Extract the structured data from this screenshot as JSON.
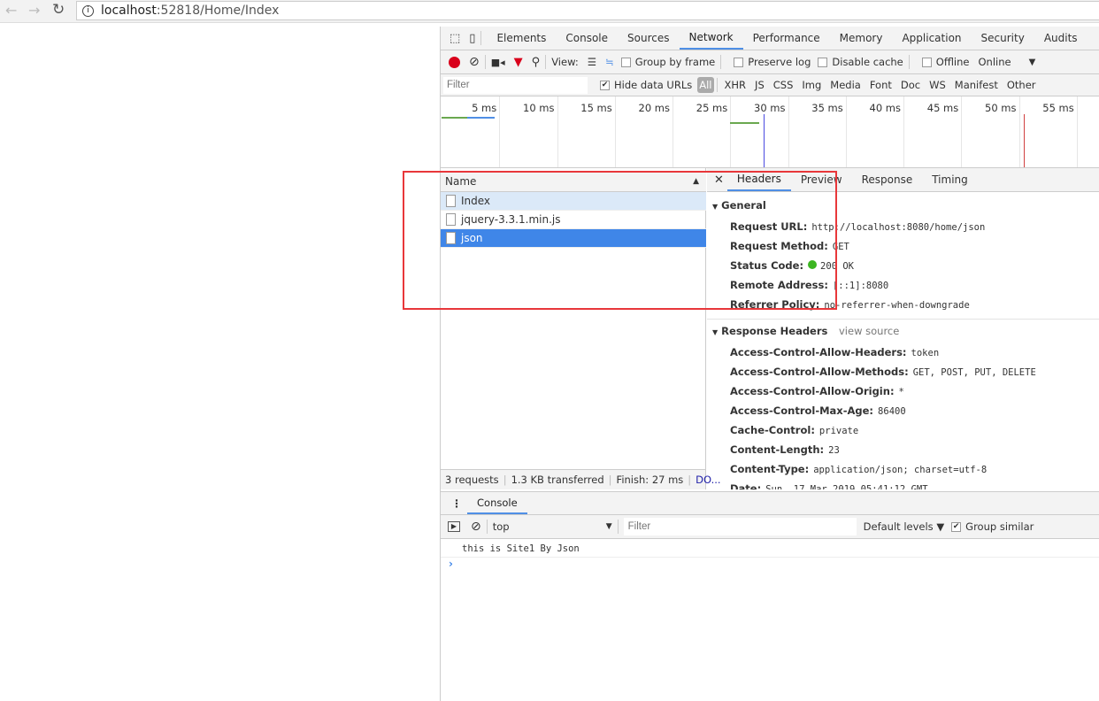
{
  "browser": {
    "back_icon": "arrow-left",
    "forward_icon": "arrow-right",
    "reload_icon": "reload",
    "info_icon": "info-circle",
    "url_host": "localhost",
    "url_rest": ":52818/Home/Index"
  },
  "devtools": {
    "tabs": [
      "Elements",
      "Console",
      "Sources",
      "Network",
      "Performance",
      "Memory",
      "Application",
      "Security",
      "Audits"
    ],
    "active_tab": "Network",
    "toolbar": {
      "view_label": "View:",
      "group_by_frame": "Group by frame",
      "preserve_log": "Preserve log",
      "disable_cache": "Disable cache",
      "offline": "Offline",
      "throttle": "Online",
      "record_color": "#d9001b"
    },
    "filterbar": {
      "placeholder": "Filter",
      "hide_data_urls": "Hide data URLs",
      "types": [
        "All",
        "XHR",
        "JS",
        "CSS",
        "Img",
        "Media",
        "Font",
        "Doc",
        "WS",
        "Manifest",
        "Other"
      ]
    },
    "timeline": {
      "ticks": [
        "5 ms",
        "10 ms",
        "15 ms",
        "20 ms",
        "25 ms",
        "30 ms",
        "35 ms",
        "40 ms",
        "45 ms",
        "50 ms",
        "55 ms"
      ],
      "dom_content_loaded_ms": 28,
      "load_ms": 50.5
    },
    "requests": {
      "header": "Name",
      "items": [
        "Index",
        "jquery-3.3.1.min.js",
        "json"
      ],
      "selected": "json"
    },
    "status": {
      "requests": "3 requests",
      "transferred": "1.3 KB transferred",
      "finish": "Finish: 27 ms",
      "dom": "DO..."
    },
    "detail": {
      "tabs": [
        "Headers",
        "Preview",
        "Response",
        "Timing"
      ],
      "active": "Headers",
      "general_title": "General",
      "general": [
        {
          "k": "Request URL:",
          "v": "http://localhost:8080/home/json"
        },
        {
          "k": "Request Method:",
          "v": "GET"
        },
        {
          "k": "Status Code:",
          "v": "200 OK"
        },
        {
          "k": "Remote Address:",
          "v": "[::1]:8080"
        },
        {
          "k": "Referrer Policy:",
          "v": "no-referrer-when-downgrade"
        }
      ],
      "response_title": "Response Headers",
      "view_source": "view source",
      "response": [
        {
          "k": "Access-Control-Allow-Headers:",
          "v": "token"
        },
        {
          "k": "Access-Control-Allow-Methods:",
          "v": "GET, POST, PUT, DELETE"
        },
        {
          "k": "Access-Control-Allow-Origin:",
          "v": "*"
        },
        {
          "k": "Access-Control-Max-Age:",
          "v": "86400"
        },
        {
          "k": "Cache-Control:",
          "v": "private"
        },
        {
          "k": "Content-Length:",
          "v": "23"
        },
        {
          "k": "Content-Type:",
          "v": "application/json; charset=utf-8"
        },
        {
          "k": "Date:",
          "v": "Sun, 17 Mar 2019 05:41:12 GMT"
        }
      ]
    },
    "console": {
      "tab": "Console",
      "context": "top",
      "filter_placeholder": "Filter",
      "levels": "Default levels ▼",
      "group_similar": "Group similar",
      "messages": [
        "this is Site1 By Json"
      ],
      "prompt": "›"
    }
  },
  "annotation": {
    "color": "#e8373a"
  }
}
